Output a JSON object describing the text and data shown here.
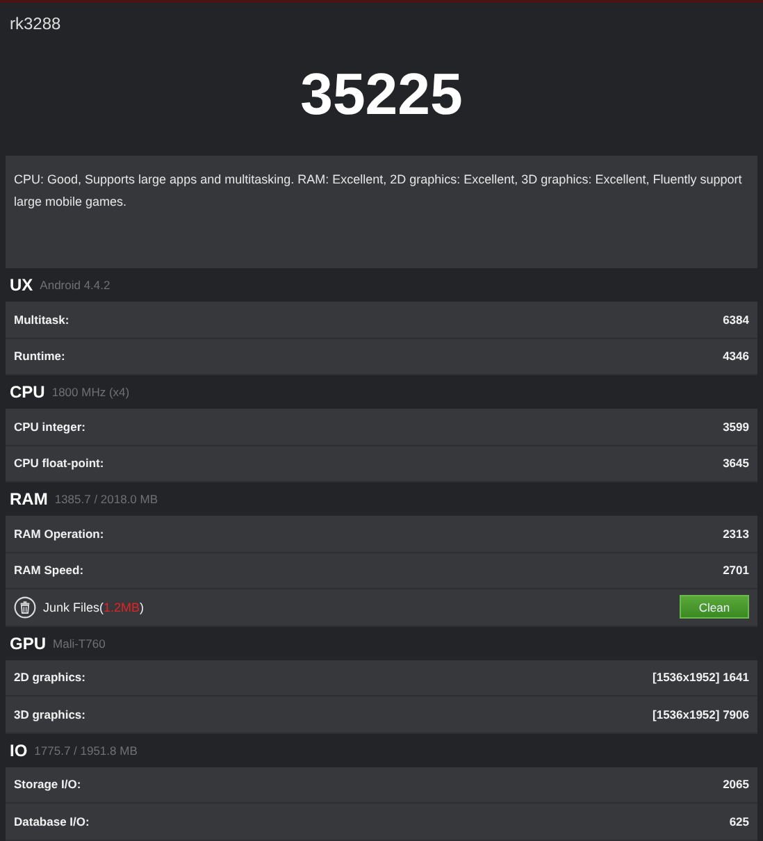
{
  "device": "rk3288",
  "score": "35225",
  "summary": "CPU: Good, Supports large apps and multitasking. RAM: Excellent, 2D graphics: Excellent, 3D graphics: Excellent, Fluently support large mobile games.",
  "sections": [
    {
      "title": "UX",
      "subtitle": "Android 4.4.2",
      "rows": [
        {
          "kind": "score",
          "label": "Multitask:",
          "value": "6384"
        },
        {
          "kind": "score",
          "label": "Runtime:",
          "value": "4346"
        }
      ]
    },
    {
      "title": "CPU",
      "subtitle": "1800 MHz (x4)",
      "rows": [
        {
          "kind": "score",
          "label": "CPU integer:",
          "value": "3599"
        },
        {
          "kind": "score",
          "label": "CPU float-point:",
          "value": "3645"
        }
      ]
    },
    {
      "title": "RAM",
      "subtitle": "1385.7 / 2018.0 MB",
      "rows": [
        {
          "kind": "score",
          "label": "RAM Operation:",
          "value": "2313"
        },
        {
          "kind": "score",
          "label": "RAM Speed:",
          "value": "2701"
        },
        {
          "kind": "junk",
          "label": "Junk Files(",
          "size": "1.2MB",
          "close": ")",
          "button": "Clean"
        }
      ]
    },
    {
      "title": "GPU",
      "subtitle": "Mali-T760",
      "rows": [
        {
          "kind": "score",
          "label": "2D graphics:",
          "value": "[1536x1952] 1641"
        },
        {
          "kind": "score",
          "label": "3D graphics:",
          "value": "[1536x1952] 7906"
        }
      ]
    },
    {
      "title": "IO",
      "subtitle": "1775.7 / 1951.8 MB",
      "rows": [
        {
          "kind": "score",
          "label": "Storage I/O:",
          "value": "2065"
        },
        {
          "kind": "score",
          "label": "Database I/O:",
          "value": "625"
        }
      ]
    }
  ]
}
